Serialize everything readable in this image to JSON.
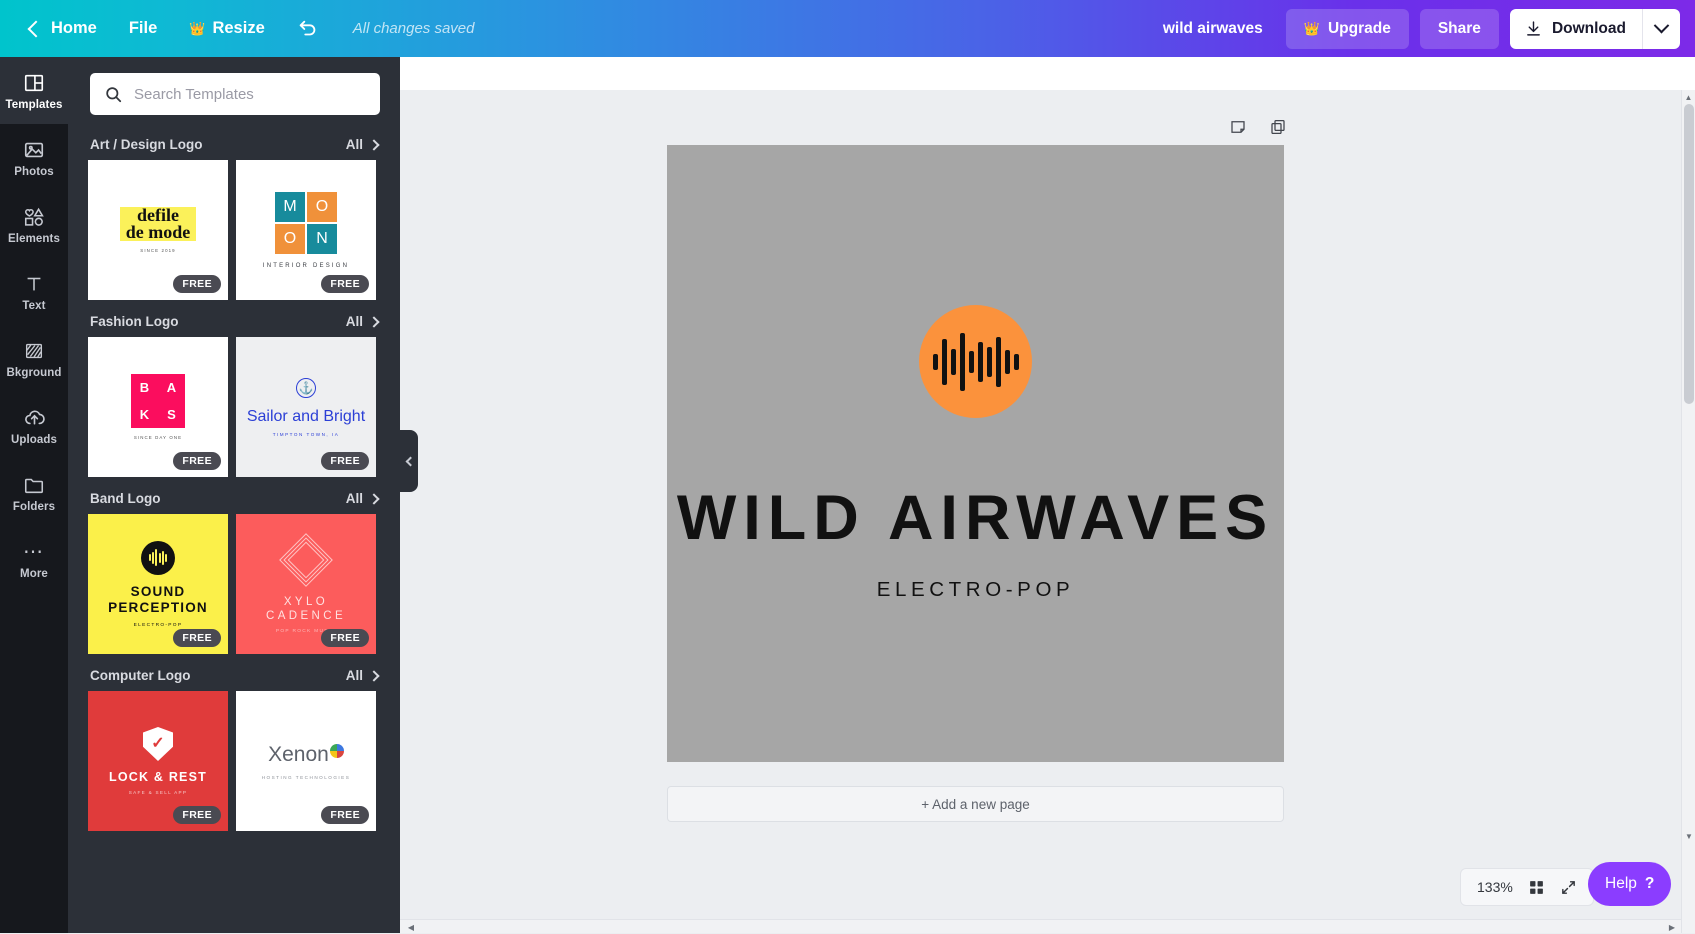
{
  "header": {
    "home_label": "Home",
    "file_label": "File",
    "resize_label": "Resize",
    "undo_name": "undo-icon",
    "save_status": "All changes saved",
    "doc_title": "wild airwaves",
    "upgrade_label": "Upgrade",
    "share_label": "Share",
    "download_label": "Download",
    "gradient_start": "#00c4cc",
    "gradient_end": "#7d2ae8"
  },
  "rail": {
    "items": [
      {
        "label": "Templates",
        "icon": "templates-icon",
        "active": true
      },
      {
        "label": "Photos",
        "icon": "photos-icon",
        "active": false
      },
      {
        "label": "Elements",
        "icon": "elements-icon",
        "active": false
      },
      {
        "label": "Text",
        "icon": "text-icon",
        "active": false
      },
      {
        "label": "Bkground",
        "icon": "background-icon",
        "active": false
      },
      {
        "label": "Uploads",
        "icon": "uploads-icon",
        "active": false
      },
      {
        "label": "Folders",
        "icon": "folders-icon",
        "active": false
      },
      {
        "label": "More",
        "icon": "more-icon",
        "active": false
      }
    ]
  },
  "search": {
    "placeholder": "Search Templates",
    "value": ""
  },
  "panel": {
    "all_label": "All",
    "free_badge": "FREE",
    "sections": [
      {
        "title": "Art / Design Logo",
        "templates": [
          {
            "name": "defile-de-mode",
            "line1": "defile",
            "line2": "de mode",
            "sub": "SINCE 2019",
            "bg": "#ffffff",
            "highlight": "#fbf15a"
          },
          {
            "name": "moon-interior-design",
            "letters": [
              "M",
              "O",
              "O",
              "N"
            ],
            "caption": "INTERIOR DESIGN",
            "bg": "#ffffff",
            "color_a": "#178b9c",
            "color_b": "#f0913a"
          }
        ]
      },
      {
        "title": "Fashion Logo",
        "templates": [
          {
            "name": "baks",
            "letters": [
              "B",
              "A",
              "K",
              "S"
            ],
            "sub": "SINCE DAY ONE",
            "bg": "#ffffff",
            "accent": "#fb0d5e"
          },
          {
            "name": "sailor-and-bright",
            "title": "Sailor and Bright",
            "sub": "TIMPTON TOWN, IA",
            "bg": "#eeeff1",
            "accent": "#2b3fd6"
          }
        ]
      },
      {
        "title": "Band Logo",
        "templates": [
          {
            "name": "sound-perception",
            "line1": "SOUND",
            "line2": "PERCEPTION",
            "sub": "ELECTRO-POP",
            "bg": "#fbf04a"
          },
          {
            "name": "xylo-cadence",
            "line1": "XYLO",
            "line2": "CADENCE",
            "sub": "POP ROCK MUSIC",
            "bg": "#fc5c5c"
          }
        ]
      },
      {
        "title": "Computer Logo",
        "templates": [
          {
            "name": "lock-and-rest",
            "title": "LOCK & REST",
            "sub": "SAFE & SELL APP",
            "bg": "#e03b3b"
          },
          {
            "name": "xenon",
            "title": "Xenon",
            "sub": "HOSTING TECHNOLOGIES",
            "bg": "#ffffff"
          }
        ]
      }
    ]
  },
  "canvas": {
    "logo_title": "WILD AIRWAVES",
    "logo_subtitle": "ELECTRO-POP",
    "artboard_bg": "#a6a6a6",
    "circle_color": "#fb923c",
    "add_page_label": "+ Add a new page"
  },
  "footer": {
    "zoom_level": "133%",
    "grid_view_icon": "grid-view-icon",
    "fullscreen_icon": "expand-icon",
    "help_label": "Help",
    "help_mark": "?"
  }
}
